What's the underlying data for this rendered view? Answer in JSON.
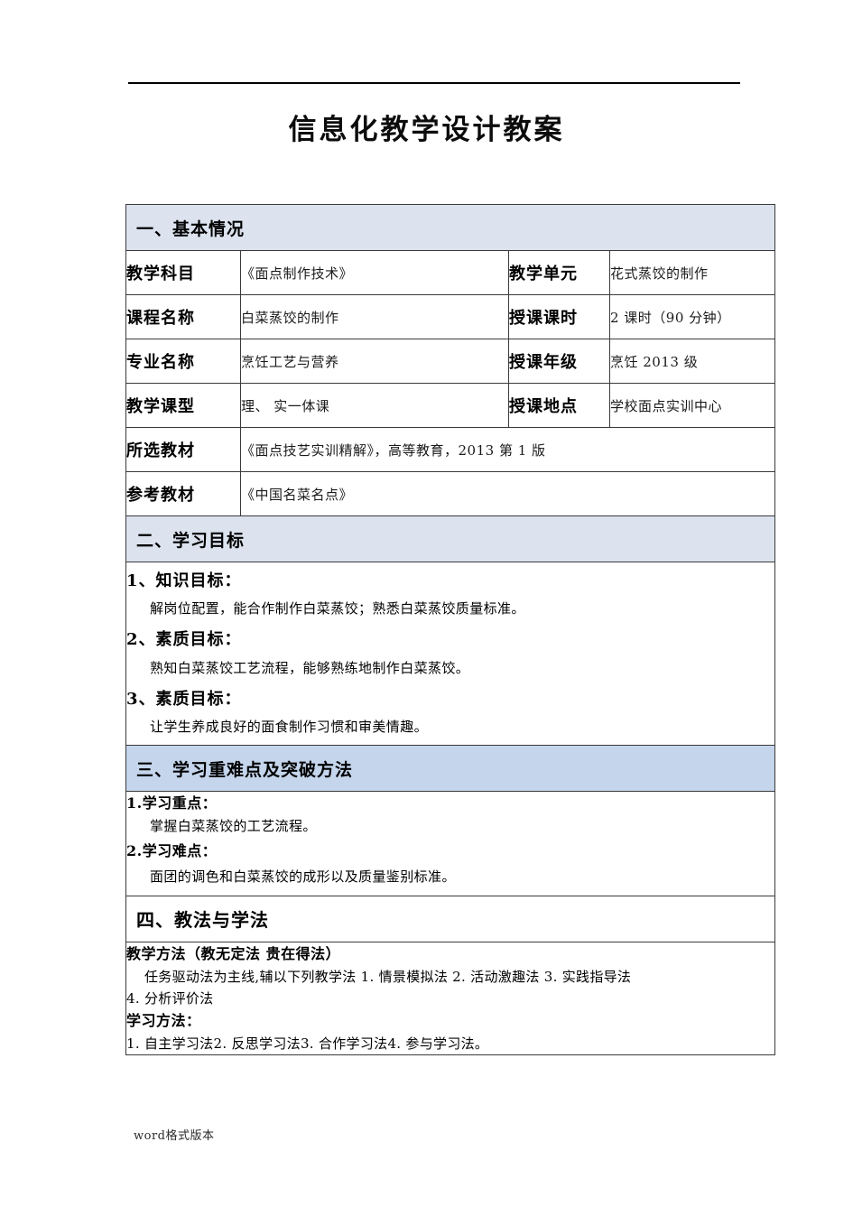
{
  "document": {
    "title": "信息化教学设计教案",
    "footer_note": "word格式版本"
  },
  "colors": {
    "section_banner_light": "#dce3ef",
    "section_banner_mid": "#c4d5ec",
    "border": "#3a3a3a",
    "text": "#000000"
  },
  "sections": {
    "basic_info": {
      "heading": "一、基本情况",
      "rows": [
        {
          "label_left": "教学科目",
          "value_left": "《面点制作技术》",
          "label_right": "教学单元",
          "value_right": "花式蒸饺的制作"
        },
        {
          "label_left": "课程名称",
          "value_left": "白菜蒸饺的制作",
          "label_right": "授课课时",
          "value_right": "2 课时（90 分钟）"
        },
        {
          "label_left": "专业名称",
          "value_left": "烹饪工艺与营养",
          "label_right": "授课年级",
          "value_right": "烹饪 2013 级"
        },
        {
          "label_left": "教学课型",
          "value_left": "理、 实一体课",
          "label_right": "授课地点",
          "value_right": "学校面点实训中心"
        }
      ],
      "wide_rows": [
        {
          "label": "所选教材",
          "value": "《面点技艺实训精解》，高等教育，2013 第 1 版"
        },
        {
          "label": "参考教材",
          "value": "《中国名菜名点》"
        }
      ]
    },
    "learning_goals": {
      "heading": "二、学习目标",
      "items": [
        {
          "title": "1、知识目标：",
          "body": "解岗位配置，能合作制作白菜蒸饺；熟悉白菜蒸饺质量标准。"
        },
        {
          "title": "2、素质目标：",
          "body": "熟知白菜蒸饺工艺流程，能够熟练地制作白菜蒸饺。"
        },
        {
          "title": "3、素质目标：",
          "body": "让学生养成良好的面食制作习惯和审美情趣。"
        }
      ]
    },
    "key_difficulties": {
      "heading": "三、学习重难点及突破方法",
      "items": [
        {
          "title": "1.学习重点：",
          "body": "掌握白菜蒸饺的工艺流程。"
        },
        {
          "title": "2.学习难点：",
          "body": "面团的调色和白菜蒸饺的成形以及质量鉴别标准。"
        }
      ]
    },
    "methods": {
      "heading": "四、教法与学法",
      "teaching_title": "教学方法（教无定法 贵在得法）",
      "teaching_line1": "任务驱动法为主线,辅以下列教学法 1. 情景模拟法 2. 活动激趣法 3. 实践指导法",
      "teaching_line2": "4. 分析评价法",
      "learning_title": "学习方法：",
      "learning_line": "1. 自主学习法2. 反思学习法3. 合作学习法4. 参与学习法。"
    }
  }
}
